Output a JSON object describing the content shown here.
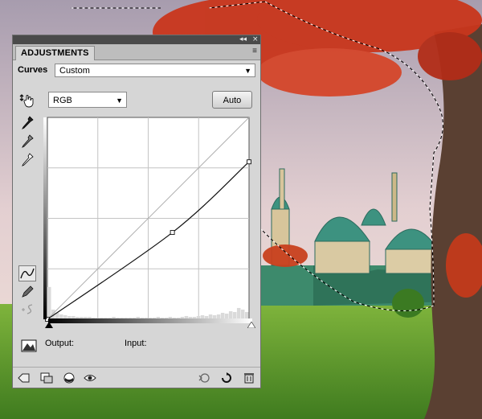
{
  "panel": {
    "tab_label": "ADJUSTMENTS",
    "preset_label": "Curves",
    "preset_value": "Custom",
    "channel_value": "RGB",
    "auto_label": "Auto",
    "output_label": "Output:",
    "input_label": "Input:",
    "title_controls": {
      "collapse": "◂◂",
      "close": "×"
    },
    "menu_icon": "≡"
  },
  "curve": {
    "points": [
      [
        0,
        0
      ],
      [
        62,
        43
      ],
      [
        100,
        78
      ]
    ],
    "grid_divisions": 4
  },
  "histogram": {
    "bins": [
      40,
      12,
      8,
      6,
      5,
      4,
      4,
      3,
      3,
      3,
      3,
      2,
      2,
      2,
      2,
      2,
      3,
      2,
      2,
      2,
      2,
      2,
      3,
      2,
      2,
      2,
      2,
      3,
      2,
      2,
      3,
      2,
      2,
      3,
      4,
      3,
      3,
      4,
      5,
      4,
      6,
      5,
      6,
      8,
      7,
      10,
      9,
      14,
      12,
      9
    ]
  },
  "colors": {
    "sky_top": "#b5a9b9",
    "sky_bottom": "#e9d3d0",
    "grass": "#5f9a2e",
    "foliage": "#c2331c"
  }
}
